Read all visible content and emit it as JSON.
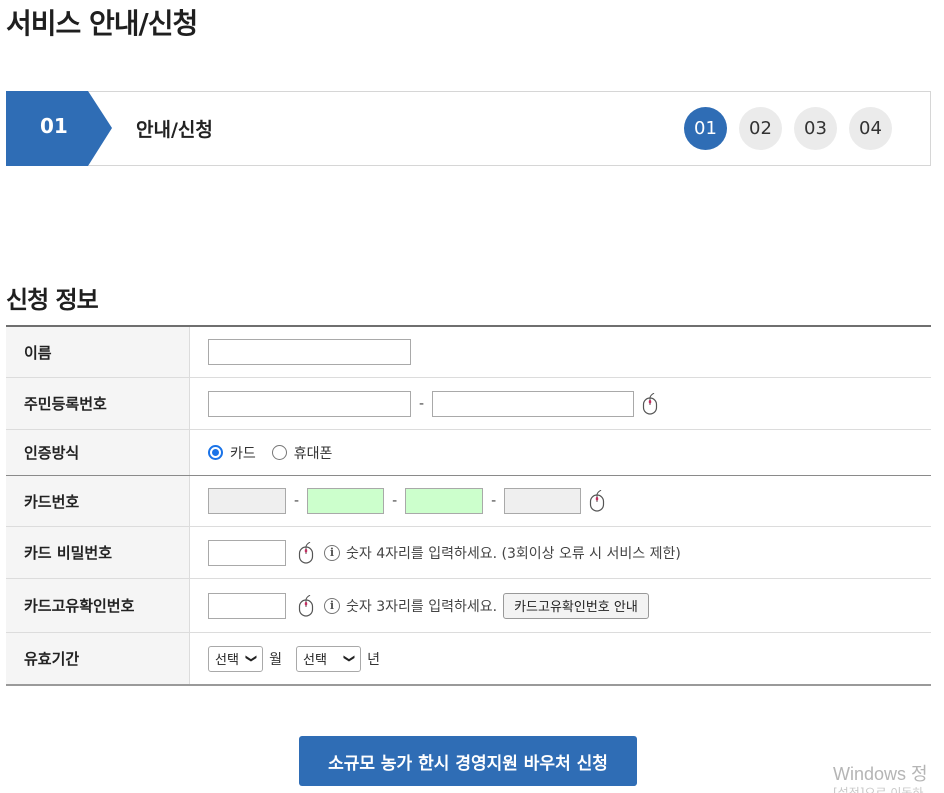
{
  "page": {
    "title": "서비스 안내/신청"
  },
  "steps": {
    "current_num": "01",
    "current_label": "안내/신청",
    "items": [
      "01",
      "02",
      "03",
      "04"
    ],
    "active_index": 0
  },
  "section": {
    "title": "신청 정보"
  },
  "form": {
    "name_label": "이름",
    "name_value": "",
    "rrn_label": "주민등록번호",
    "rrn_front": "",
    "rrn_back": "",
    "rrn_sep": "-",
    "auth_label": "인증방식",
    "auth_options": [
      "카드",
      "휴대폰"
    ],
    "auth_selected": "카드",
    "card_label": "카드번호",
    "card_sep": "-",
    "pw_label": "카드 비밀번호",
    "pw_hint": "숫자 4자리를 입력하세요. (3회이상 오류 시 서비스 제한)",
    "cvc_label": "카드고유확인번호",
    "cvc_hint": "숫자 3자리를 입력하세요.",
    "cvc_button": "카드고유확인번호 안내",
    "exp_label": "유효기간",
    "exp_month_value": "선택",
    "exp_month_unit": "월",
    "exp_year_value": "선택",
    "exp_year_unit": "년"
  },
  "submit": {
    "label": "소규모 농가 한시 경영지원 바우처 신청"
  },
  "watermark": {
    "line1": "Windows 정",
    "line2": "[설정]으로 이동하"
  },
  "colors": {
    "accent": "#2f6db5",
    "green_input": "#ccffcc",
    "grey_input": "#efefef"
  },
  "icons": {
    "mouse": "mouse-icon",
    "info": "info-icon",
    "caret": "chevron-down-icon"
  }
}
